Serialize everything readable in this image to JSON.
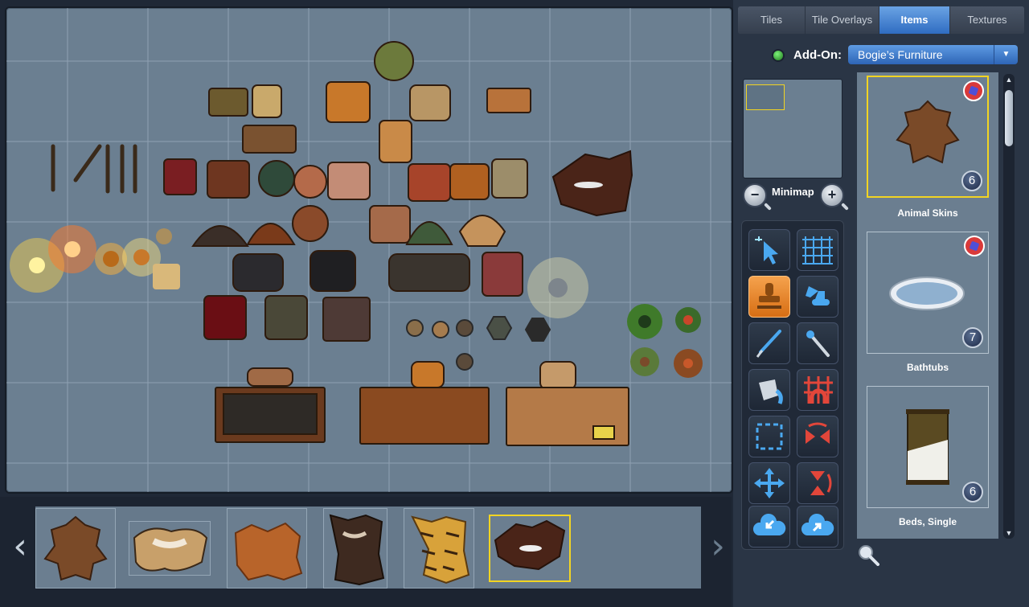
{
  "tabs": [
    {
      "label": "Tiles",
      "active": false
    },
    {
      "label": "Tile Overlays",
      "active": false
    },
    {
      "label": "Items",
      "active": true
    },
    {
      "label": "Textures",
      "active": false
    }
  ],
  "addon": {
    "label": "Add-On:",
    "selected": "Bogie’s Furniture"
  },
  "minimap": {
    "label": "Minimap"
  },
  "tools": [
    {
      "icon": "select-pointer-icon",
      "active": false
    },
    {
      "icon": "grid-icon",
      "active": false
    },
    {
      "icon": "stamp-icon",
      "active": true
    },
    {
      "icon": "excavator-icon",
      "active": false
    },
    {
      "icon": "brush-icon",
      "active": false
    },
    {
      "icon": "magic-wand-icon",
      "active": false
    },
    {
      "icon": "paint-bucket-icon",
      "active": false
    },
    {
      "icon": "grid-magnet-icon",
      "active": false
    },
    {
      "icon": "selection-rectangle-icon",
      "active": false
    },
    {
      "icon": "flip-horizontal-icon",
      "active": false
    },
    {
      "icon": "move-icon",
      "active": false
    },
    {
      "icon": "flip-vertical-icon",
      "active": false
    },
    {
      "icon": "cloud-import-icon",
      "active": false
    },
    {
      "icon": "cloud-export-icon",
      "active": false
    }
  ],
  "categories": [
    {
      "label": "Animal Skins",
      "count": "6",
      "selected": true,
      "icon": "bear-skin-rug"
    },
    {
      "label": "Bathtubs",
      "count": "7",
      "selected": false,
      "icon": "bathtub"
    },
    {
      "label": "Beds, Single",
      "count": "6",
      "selected": false,
      "icon": "single-bed"
    }
  ],
  "tray": {
    "items": [
      {
        "name": "bear-skin-rug",
        "selected": false
      },
      {
        "name": "cow-hide-rug",
        "selected": false
      },
      {
        "name": "leather-hide-rug",
        "selected": false
      },
      {
        "name": "dark-hide-rug",
        "selected": false
      },
      {
        "name": "tiger-skin-rug",
        "selected": false
      },
      {
        "name": "brown-cowhide-rug",
        "selected": true
      }
    ]
  },
  "colors": {
    "canvas": "#6b7f91",
    "accent": "#2f6cc1",
    "highlight": "#f2d422",
    "active_tool": "#e88a2c"
  }
}
